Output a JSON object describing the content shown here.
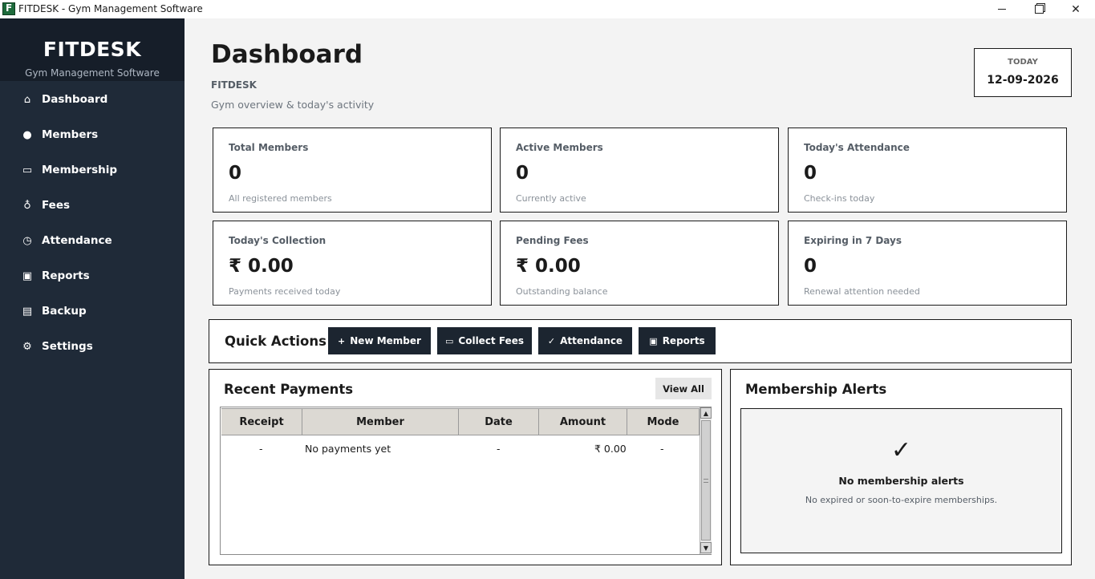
{
  "window": {
    "title": "FITDESK - Gym Management Software",
    "app_icon": "fitdesk-logo-icon"
  },
  "sidebar": {
    "brand_title": "FITDESK",
    "brand_subtitle": "Gym Management Software",
    "background": "#1f2a38",
    "items": [
      {
        "label": "Dashboard",
        "icon": "home-icon",
        "glyph": "⌂"
      },
      {
        "label": "Members",
        "icon": "user-icon",
        "glyph": "●"
      },
      {
        "label": "Membership",
        "icon": "card-icon",
        "glyph": "▭"
      },
      {
        "label": "Fees",
        "icon": "money-bag-icon",
        "glyph": "♁"
      },
      {
        "label": "Attendance",
        "icon": "clock-icon",
        "glyph": "◷"
      },
      {
        "label": "Reports",
        "icon": "report-icon",
        "glyph": "▣"
      },
      {
        "label": "Backup",
        "icon": "save-icon",
        "glyph": "▤"
      },
      {
        "label": "Settings",
        "icon": "gear-icon",
        "glyph": "⚙"
      }
    ]
  },
  "header": {
    "title": "Dashboard",
    "brand": "FITDESK",
    "subtitle": "Gym overview & today's activity",
    "today_label": "TODAY",
    "today_date": "12-09-2026"
  },
  "stats": [
    {
      "label": "Total Members",
      "value": "0",
      "sub": "All registered members"
    },
    {
      "label": "Active Members",
      "value": "0",
      "sub": "Currently active"
    },
    {
      "label": "Today's Attendance",
      "value": "0",
      "sub": "Check-ins today"
    },
    {
      "label": "Today's Collection",
      "value": "₹ 0.00",
      "sub": "Payments received today"
    },
    {
      "label": "Pending Fees",
      "value": "₹ 0.00",
      "sub": "Outstanding balance"
    },
    {
      "label": "Expiring in 7 Days",
      "value": "0",
      "sub": "Renewal attention needed"
    }
  ],
  "quick_actions": {
    "title": "Quick Actions",
    "buttons": [
      {
        "label": "New Member",
        "icon": "plus-icon",
        "glyph": "+"
      },
      {
        "label": "Collect Fees",
        "icon": "card-icon",
        "glyph": "▭"
      },
      {
        "label": "Attendance",
        "icon": "check-icon",
        "glyph": "✓"
      },
      {
        "label": "Reports",
        "icon": "report-icon",
        "glyph": "▣"
      }
    ]
  },
  "recent_payments": {
    "title": "Recent Payments",
    "view_all": "View All",
    "columns": [
      "Receipt",
      "Member",
      "Date",
      "Amount",
      "Mode"
    ],
    "rows": [
      [
        "-",
        "No payments yet",
        "-",
        "₹ 0.00",
        "-"
      ]
    ]
  },
  "membership_alerts": {
    "title": "Membership Alerts",
    "icon": "check-icon",
    "glyph": "✓",
    "empty_title": "No membership alerts",
    "empty_sub": "No expired or soon-to-expire memberships."
  }
}
